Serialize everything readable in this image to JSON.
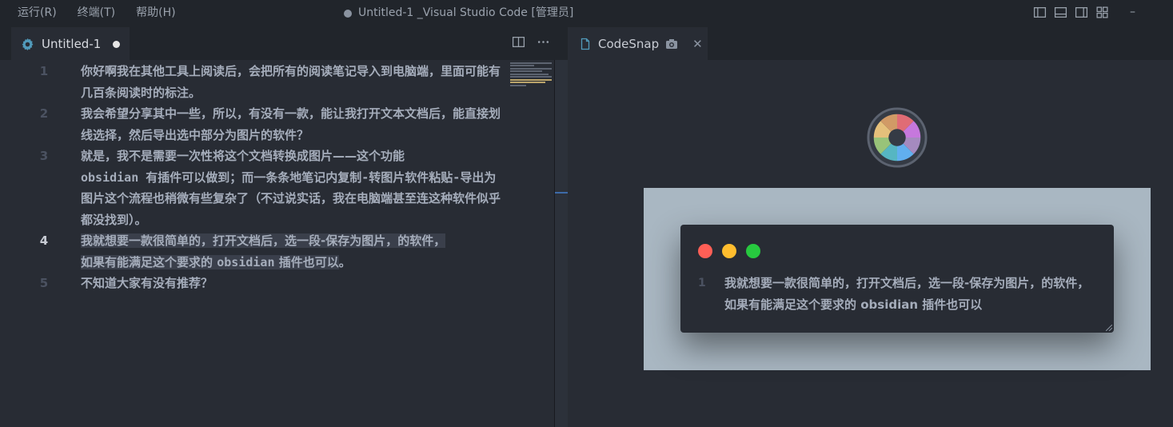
{
  "menu": {
    "items": [
      "运行(R)",
      "终端(T)",
      "帮助(H)"
    ]
  },
  "window": {
    "title": "Untitled-1 _Visual Studio Code [管理员]"
  },
  "controls": {
    "minimize": "–"
  },
  "editor": {
    "tab_label": "Untitled-1",
    "lines": [
      {
        "num": "1",
        "text": "你好啊我在其他工具上阅读后，会把所有的阅读笔记导入到电脑端，里面可能有几百条阅读时的标注。"
      },
      {
        "num": "2",
        "text": "我会希望分享其中一些，所以，有没有一款，能让我打开文本文档后，能直接划线选择，然后导出选中部分为图片的软件？"
      },
      {
        "num": "3",
        "text_a": "就是，我不是需要一次性将这个文档转换成图片——这个功能",
        "text_b": "obsidian 有插件可以做到；而一条条地笔记内复制-转图片软件粘贴-导出为图片这个流程也稍微有些复杂了（不过说实话，我在电脑端甚至连这种软件似乎都没找到）。"
      },
      {
        "num": "4",
        "text_a": "我就想要一款很简单的，打开文档后，选一段-保存为图片，的软件，",
        "text_b": "如果有能满足这个要求的 ",
        "text_c": "obsidian",
        "text_d": " 插件也可以",
        "text_e": "。"
      },
      {
        "num": "5",
        "text": "不知道大家有没有推荐？"
      }
    ]
  },
  "codesnap": {
    "tab_label": "CodeSnap",
    "snippet_line_num": "1",
    "snippet_text": "我就想要一款很简单的，打开文档后，选一段-保存为图片，的软件，如果有能满足这个要求的 obsidian 插件也可以",
    "traffic_colors": [
      "#ff5f56",
      "#ffbd2e",
      "#27c93f"
    ]
  }
}
